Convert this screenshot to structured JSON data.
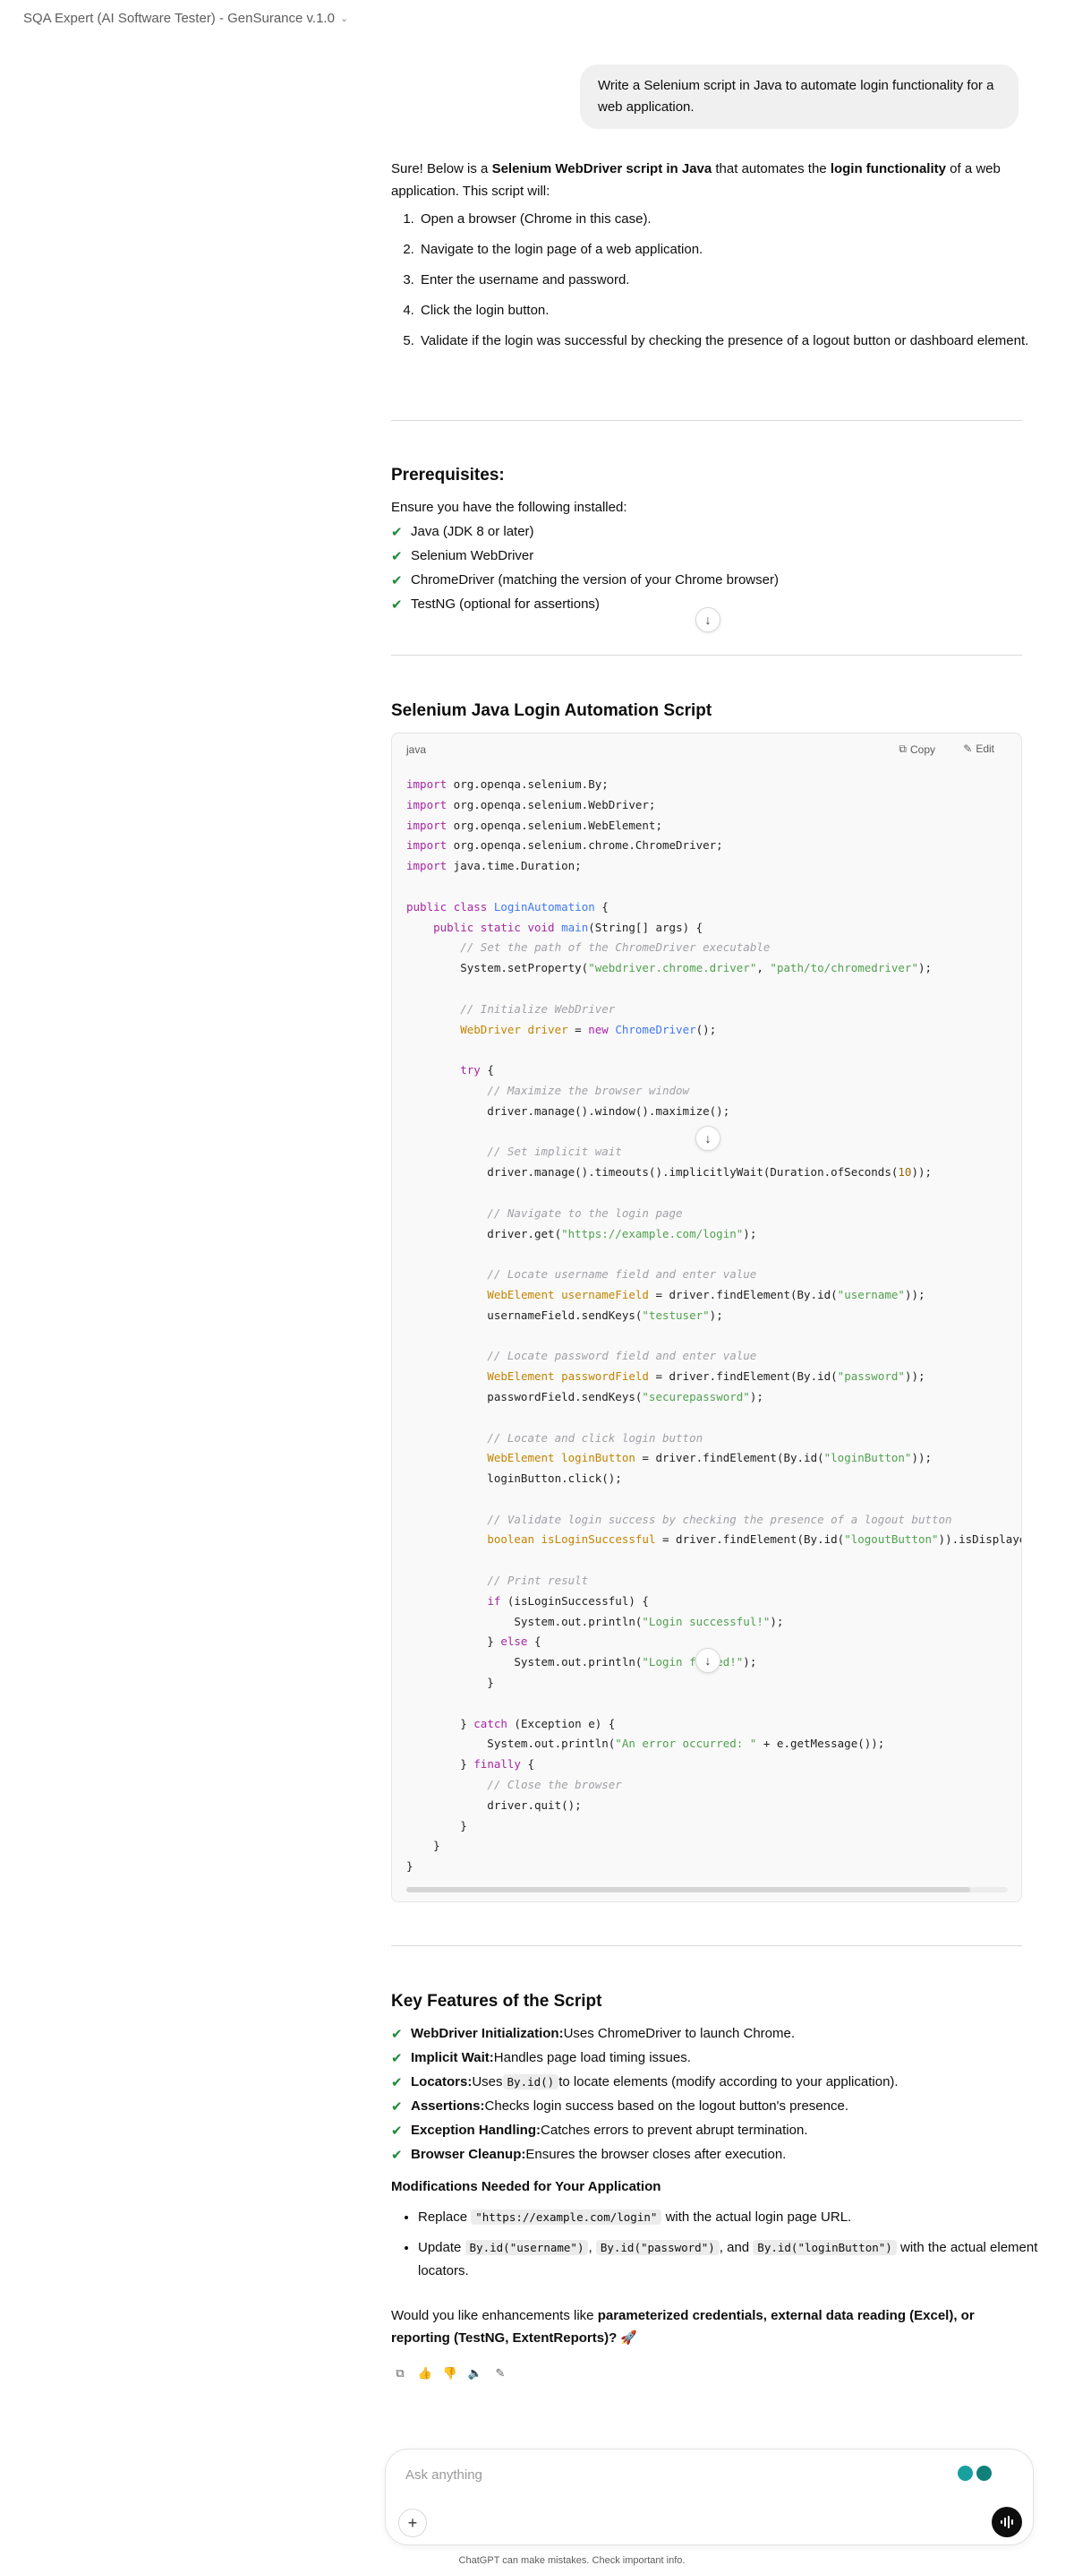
{
  "app": {
    "title": "SQA Expert (AI Software Tester) - GenSurance v.1.0"
  },
  "user_message": "Write a Selenium script in Java to automate login functionality for a web application.",
  "intro": {
    "t1": "Sure! Below is a ",
    "b1": "Selenium WebDriver script in Java",
    "t2": " that automates the ",
    "b2": "login functionality",
    "t3": " of a web application. This script will:"
  },
  "steps": [
    "Open a browser (Chrome in this case).",
    "Navigate to the login page of a web application.",
    "Enter the username and password.",
    "Click the login button.",
    "Validate if the login was successful by checking the presence of a logout button or dashboard element."
  ],
  "prereq": {
    "heading": "Prerequisites:",
    "lead": "Ensure you have the following installed:",
    "items": [
      "Java (JDK 8 or later)",
      "Selenium WebDriver",
      "ChromeDriver (matching the version of your Chrome browser)",
      "TestNG (optional for assertions)"
    ]
  },
  "script_heading": "Selenium Java Login Automation Script",
  "code": {
    "lang": "java",
    "copy": "Copy",
    "edit": "Edit"
  },
  "features": {
    "heading": "Key Features of the Script",
    "items": [
      {
        "b": "WebDriver Initialization:",
        "t": " Uses ChromeDriver to launch Chrome."
      },
      {
        "b": "Implicit Wait:",
        "t": " Handles page load timing issues."
      },
      {
        "b": "Locators:",
        "t1": " Uses ",
        "c": "By.id()",
        "t2": " to locate elements (modify according to your application)."
      },
      {
        "b": "Assertions:",
        "t": " Checks login success based on the logout button's presence."
      },
      {
        "b": "Exception Handling:",
        "t": " Catches errors to prevent abrupt termination."
      },
      {
        "b": "Browser Cleanup:",
        "t": " Ensures the browser closes after execution."
      }
    ]
  },
  "mods": {
    "heading": "Modifications Needed for Your Application",
    "m1": {
      "t1": "Replace ",
      "c": "\"https://example.com/login\"",
      "t2": " with the actual login page URL."
    },
    "m2": {
      "t1": "Update ",
      "c1": "By.id(\"username\")",
      "s1": ", ",
      "c2": "By.id(\"password\")",
      "s2": ", and ",
      "c3": "By.id(\"loginButton\")",
      "t2": " with the actual element locators."
    }
  },
  "closing": {
    "t1": "Would you like enhancements like ",
    "b": "parameterized credentials, external data reading (Excel), or reporting (TestNG, ExtentReports)?",
    "emoji": "🚀"
  },
  "composer": {
    "placeholder": "Ask anything"
  },
  "footer": "ChatGPT can make mistakes. Check important info."
}
